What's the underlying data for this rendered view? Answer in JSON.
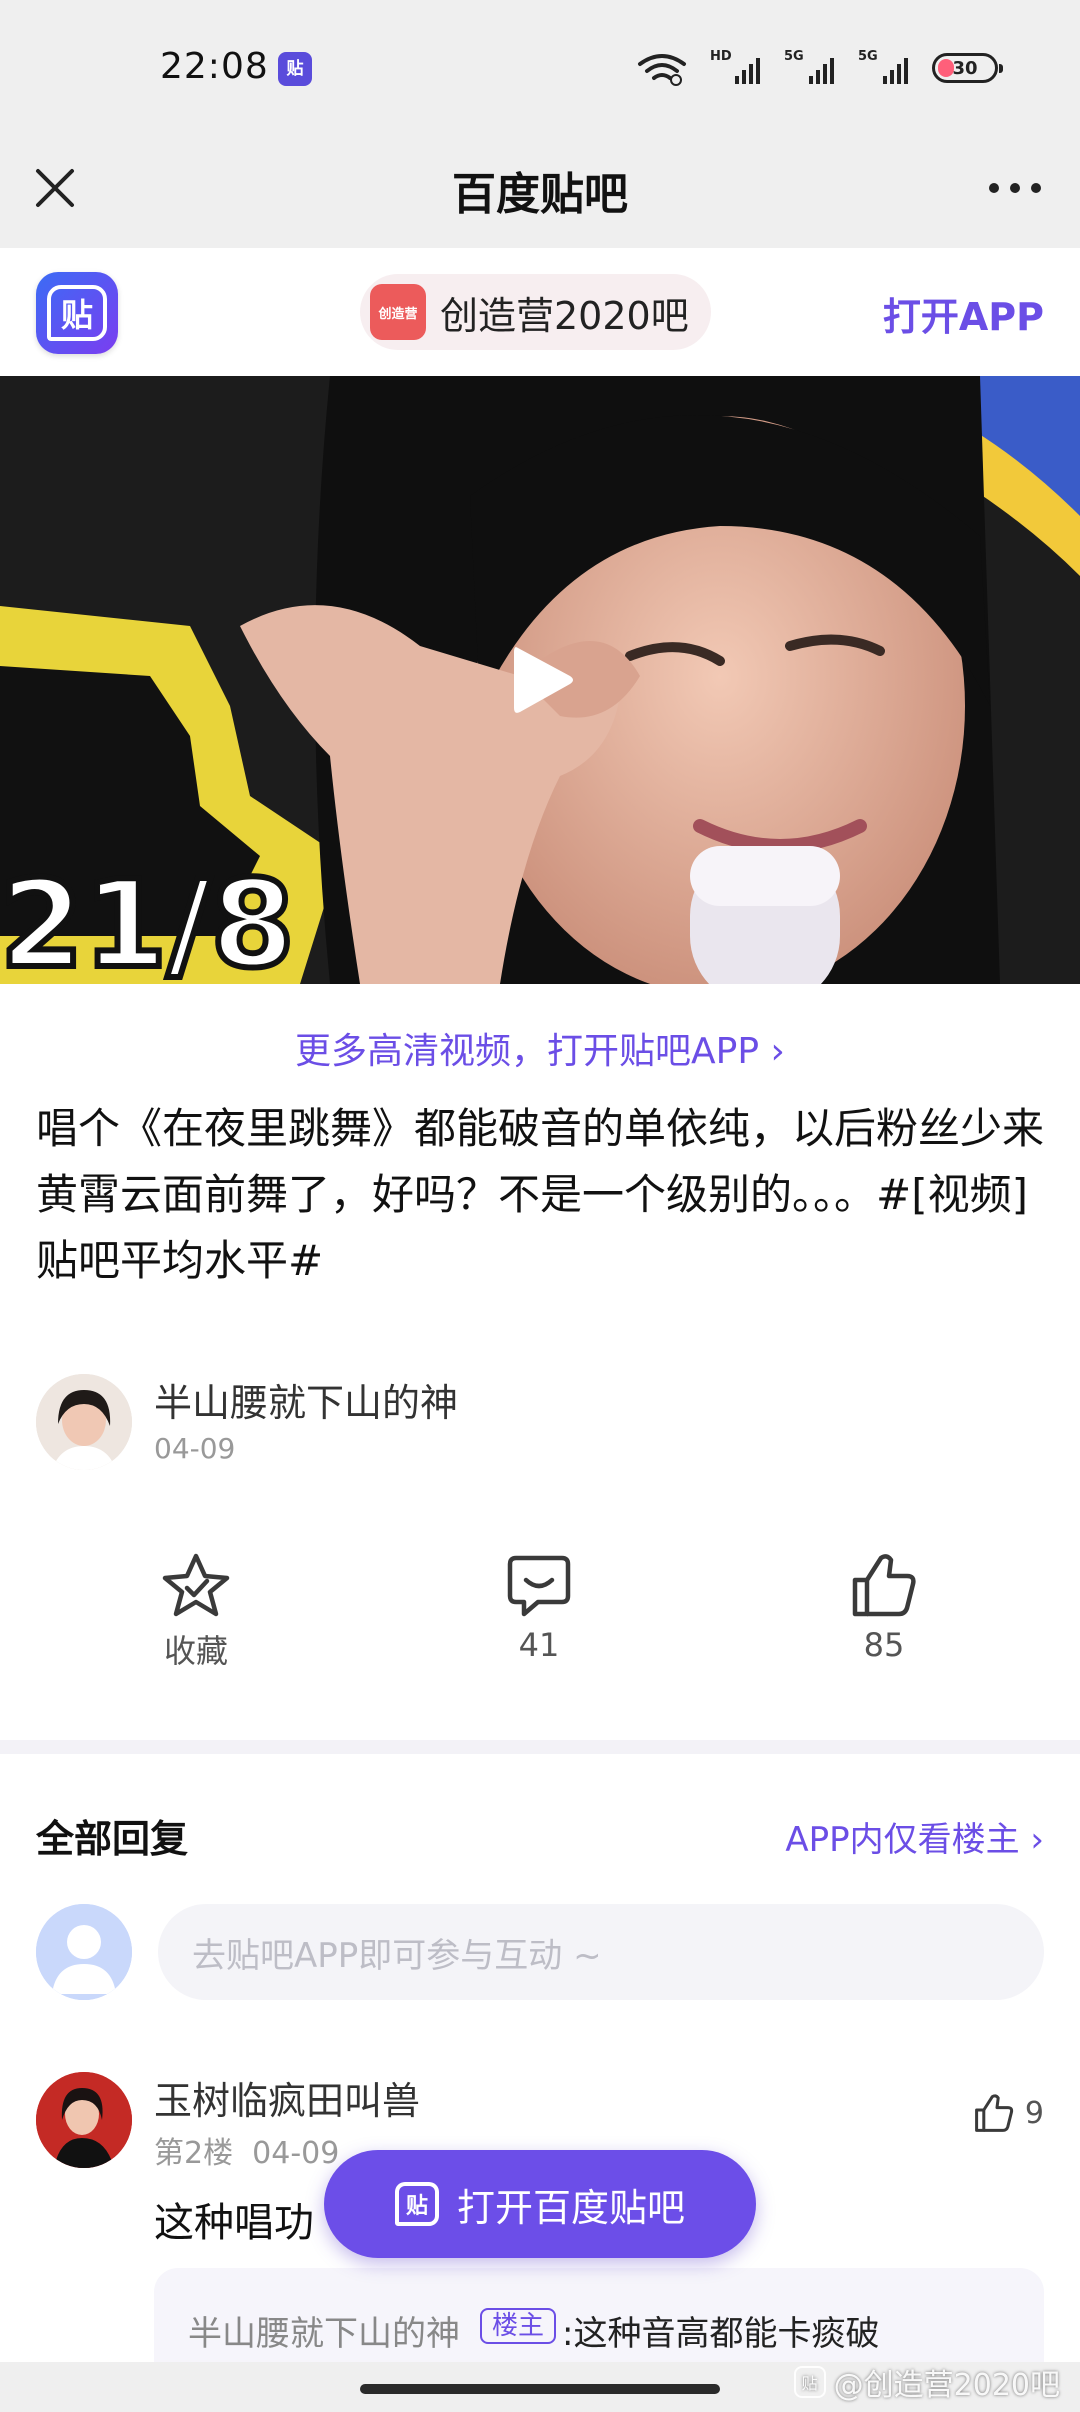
{
  "status_bar": {
    "time": "22:08",
    "app_icon_text": "贴",
    "icons": [
      "wifi-icon",
      "hd-signal-icon",
      "5g-signal-icon",
      "5g-signal-icon",
      "battery-icon"
    ],
    "signal_label_1": "HD",
    "signal_label_2": "5G",
    "signal_label_3": "5G",
    "battery": "30"
  },
  "title_bar": {
    "title": "百度贴吧",
    "close_icon": "close-icon",
    "more_icon": "more-icon"
  },
  "app_banner": {
    "logo_text": "贴",
    "forum_name": "创造营2020吧",
    "forum_icon_text": "创造营",
    "open_app": "打开APP"
  },
  "video": {
    "play_icon": "play-icon"
  },
  "more_hd_link": "更多高清视频，打开贴吧APP ›",
  "post": {
    "title": "唱个《在夜里跳舞》都能破音的单依纯，以后粉丝少来黄霄云面前舞了，好吗？不是一个级别的。。。#[视频]贴吧平均水平#",
    "author": "半山腰就下山的神",
    "date": "04-09"
  },
  "actions": {
    "favorite_label": "收藏",
    "comment_count": "41",
    "like_count": "85"
  },
  "replies": {
    "title": "全部回复",
    "only_op_link": "APP内仅看楼主 ›",
    "input_placeholder": "去贴吧APP即可参与互动 ~",
    "items": [
      {
        "name": "玉树临疯田叫兽",
        "floor": "第2楼",
        "date": "04-09",
        "likes": "9",
        "body": "这种唱功",
        "quote_author": "半山腰就下山的神",
        "op_badge": "楼主",
        "quote_text": ":这种音高都能卡痰破"
      }
    ]
  },
  "floating_button": {
    "icon_text": "贴",
    "label": "打开百度贴吧"
  },
  "watermark": {
    "icon_text": "贴",
    "text": "@创造营2020吧"
  },
  "colors": {
    "accent": "#6b4ee6",
    "background": "#ffffff",
    "chrome": "#efefef"
  }
}
